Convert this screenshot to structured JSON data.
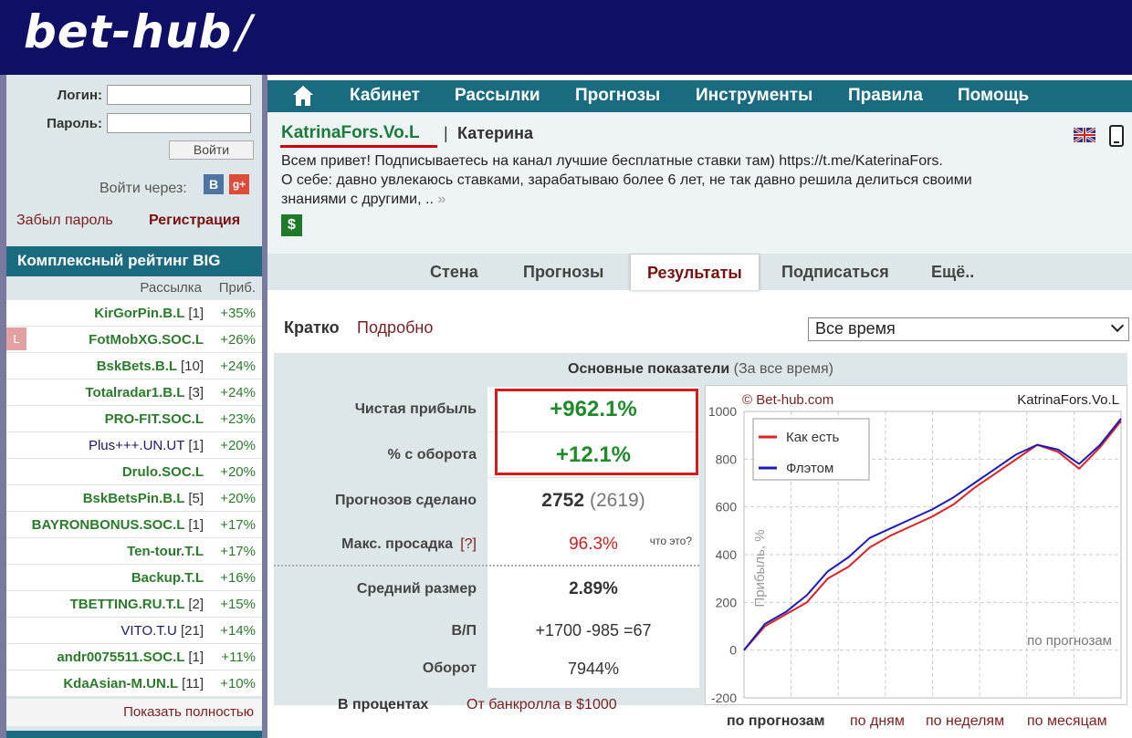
{
  "header": {
    "logo": "bet-hub"
  },
  "login": {
    "login_label": "Логин:",
    "password_label": "Пароль:",
    "submit": "Войти",
    "via_label": "Войти через:",
    "vk": "B",
    "gplus": "g+",
    "forgot": "Забыл пароль",
    "register": "Регистрация"
  },
  "rating": {
    "title": "Комплексный рейтинг BIG",
    "col_mailing": "Рассылка",
    "col_profit": "Приб.",
    "badge": "L",
    "rows": [
      {
        "name": "KirGorPin.B.L",
        "count": "[1]",
        "pct": "+35%"
      },
      {
        "name": "FotMobXG.SOC.L",
        "count": "",
        "pct": "+26%"
      },
      {
        "name": "BskBets.B.L",
        "count": "[10]",
        "pct": "+24%"
      },
      {
        "name": "Totalradar1.B.L",
        "count": "[3]",
        "pct": "+24%"
      },
      {
        "name": "PRO-FIT.SOC.L",
        "count": "",
        "pct": "+23%"
      },
      {
        "name": "Plus+++.UN.UT",
        "count": "[1]",
        "pct": "+20%"
      },
      {
        "name": "Drulo.SOC.L",
        "count": "",
        "pct": "+20%"
      },
      {
        "name": "BskBetsPin.B.L",
        "count": "[5]",
        "pct": "+20%"
      },
      {
        "name": "BAYRONBONUS.SOC.L",
        "count": "[1]",
        "pct": "+17%"
      },
      {
        "name": "Ten-tour.T.L",
        "count": "",
        "pct": "+17%"
      },
      {
        "name": "Backup.T.L",
        "count": "",
        "pct": "+16%"
      },
      {
        "name": "TBETTING.RU.T.L",
        "count": "[2]",
        "pct": "+15%"
      },
      {
        "name": "VITO.T.U",
        "count": "[21]",
        "pct": "+14%"
      },
      {
        "name": "andr0075511.SOC.L",
        "count": "[1]",
        "pct": "+11%"
      },
      {
        "name": "KdaAsian-M.UN.L",
        "count": "[11]",
        "pct": "+10%"
      }
    ],
    "show_all": "Показать полностью"
  },
  "nav": {
    "items": [
      "Кабинет",
      "Рассылки",
      "Прогнозы",
      "Инструменты",
      "Правила",
      "Помощь"
    ]
  },
  "profile": {
    "username": "KatrinaFors.Vo.L",
    "separator": "|",
    "realname": "Катерина",
    "bio_line1": "Всем привет! Подписываетесь на канал лучшие бесплатные ставки там) https://t.me/KaterinaFors.",
    "bio_line2": "О себе: давно увлекаюсь ставками, зарабатываю более 6 лет, не так давно решила делиться своими знаниями с другими, ..",
    "more": "»",
    "dollar": "$"
  },
  "tabs": [
    "Стена",
    "Прогнозы",
    "Результаты",
    "Подписаться",
    "Ещё.."
  ],
  "results": {
    "brief": "Кратко",
    "detailed": "Подробно",
    "period": "Все время",
    "header_bold": "Основные показатели",
    "header_sub": "(За все время)",
    "net_profit_label": "Чистая прибыль",
    "net_profit": "+962.1%",
    "turnover_pct_label": "% с оборота",
    "turnover_pct": "+12.1%",
    "forecasts_label": "Прогнозов сделано",
    "forecasts": "2752",
    "forecasts_sub": "(2619)",
    "drawdown_label": "Макс. просадка",
    "drawdown_q": "[?]",
    "drawdown": "96.3%",
    "drawdown_hint": "что это?",
    "avg_size_label": "Средний размер",
    "avg_size": "2.89%",
    "wl_label": "В/П",
    "wl": "+1700 -985 =67",
    "turnover_label": "Оборот",
    "turnover": "7944%",
    "in_percent": "В процентах",
    "from_bank": "От банкролла в $1000",
    "by_forecasts": "по прогнозам",
    "by_days": "по дням",
    "by_weeks": "по неделям",
    "by_months": "по месяцам"
  },
  "chart_data": {
    "type": "line",
    "watermark": "© Bet-hub.com",
    "corner_label": "KatrinaFors.Vo.L",
    "ylabel": "Прибыль, %",
    "xlabel": "по прогнозам",
    "ylim": [
      -200,
      1000
    ],
    "yticks": [
      1000,
      800,
      600,
      400,
      200,
      0,
      -200
    ],
    "legend_placement": "top-left",
    "grid": true,
    "x": [
      0,
      25,
      50,
      75,
      100,
      125,
      150,
      175,
      200,
      225,
      250,
      275,
      300,
      325,
      350,
      375,
      400,
      425,
      450
    ],
    "series": [
      {
        "name": "Как есть",
        "color": "#dd2222",
        "values": [
          0,
          100,
          150,
          200,
          300,
          350,
          430,
          480,
          520,
          560,
          610,
          680,
          740,
          800,
          860,
          830,
          760,
          850,
          960
        ]
      },
      {
        "name": "Флэтом",
        "color": "#1b1bbb",
        "values": [
          0,
          110,
          160,
          230,
          330,
          390,
          470,
          510,
          550,
          590,
          640,
          700,
          760,
          820,
          860,
          840,
          780,
          860,
          970
        ]
      }
    ]
  }
}
